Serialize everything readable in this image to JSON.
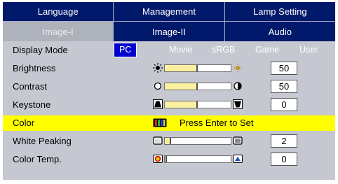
{
  "tabs_row1": [
    {
      "label": "Language"
    },
    {
      "label": "Management"
    },
    {
      "label": "Lamp Setting"
    }
  ],
  "tabs_row2": [
    {
      "label": "Image-I",
      "active": true
    },
    {
      "label": "Image-II"
    },
    {
      "label": "Audio"
    }
  ],
  "display_mode": {
    "label": "Display Mode",
    "options": [
      "PC",
      "Movie",
      "sRGB",
      "Game",
      "User"
    ],
    "selected": "PC"
  },
  "brightness": {
    "label": "Brightness",
    "value": "50",
    "level": 0.5
  },
  "contrast": {
    "label": "Contrast",
    "value": "50",
    "level": 0.5
  },
  "keystone": {
    "label": "Keystone",
    "value": "0",
    "level": 0.5
  },
  "color": {
    "label": "Color",
    "hint": "Press Enter to Set"
  },
  "white_peaking": {
    "label": "White Peaking",
    "value": "2",
    "level": 0.1
  },
  "color_temp": {
    "label": "Color Temp.",
    "value": "0",
    "level": 0.0
  },
  "colors": {
    "tab_bg": "#00196b",
    "panel_bg": "#c5c8d0",
    "highlight": "#ffff00",
    "selected_mode": "#0000d0"
  }
}
